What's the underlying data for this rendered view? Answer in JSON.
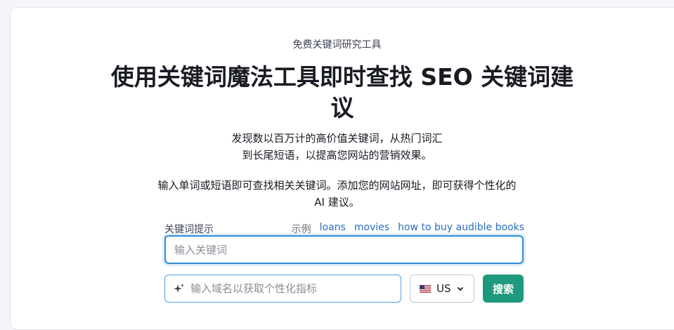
{
  "hero": {
    "eyebrow": "免费关键词研究工具",
    "headline": "使用关键词魔法工具即时查找 SEO 关键词建议",
    "subtitle_line1": "发现数以百万计的高价值关键词，从热门词汇",
    "subtitle_line2": "到长尾短语，以提高您网站的营销效果。",
    "instruction_line1": "输入单词或短语即可查找相关关键词。添加您的网站网址，即可获得个性化的",
    "instruction_line2": "AI 建议。"
  },
  "form": {
    "hint_label": "关键词提示",
    "examples_label": "示例",
    "examples": [
      "loans",
      "movies",
      "how to buy audible books"
    ],
    "keyword_placeholder": "输入关键词",
    "domain_placeholder": "输入域名以获取个性化指标",
    "country": "US",
    "search_label": "搜索"
  },
  "icons": {
    "domain_icon": "sparkle-icon",
    "country_flag": "us-flag-icon",
    "country_chevron": "chevron-down-icon"
  },
  "colors": {
    "search_button": "#1d9a7c",
    "focus_border": "#2b8ed6",
    "link": "#2b6dbf"
  }
}
